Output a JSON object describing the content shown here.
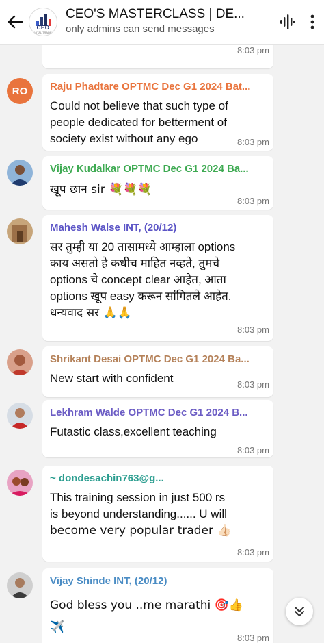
{
  "header": {
    "title": "CEO'S MASTERCLASS | DE...",
    "subtitle": "only admins can send messages",
    "logo_text": "CEO",
    "logo_sub": "VITAL TRADE"
  },
  "messages": [
    {
      "time": "8:03 pm"
    },
    {
      "avatar_initials": "RO",
      "sender": "Raju Phadtare OPTMC Dec G1 2024 Bat...",
      "sender_color": "#e9743d",
      "text_lines": [
        "Could not believe that such type of",
        "people dedicated for betterment of",
        "society exist without any ego"
      ],
      "time": "8:03 pm"
    },
    {
      "sender": "Vijay Kudalkar OPTMC Dec G1 2024 Ba...",
      "sender_color": "#3eaa52",
      "text": "खूप छान sir 💐💐💐",
      "time": "8:03 pm"
    },
    {
      "sender": "Mahesh Walse INT, (20/12)",
      "sender_color": "#5b54c6",
      "text_lines": [
        "सर तुम्ही या 20 तासामध्ये आम्हाला options",
        "काय असतो हे कधीच माहित नव्हते, तुमचे",
        "options चे concept clear आहेत, आता",
        "options खूप easy करून सांगितले आहेत.",
        "धन्यवाद सर 🙏🙏"
      ],
      "time": "8:03 pm"
    },
    {
      "sender": "Shrikant Desai OPTMC Dec G1 2024 Ba...",
      "sender_color": "#b5825a",
      "text": "New start with confident",
      "time": "8:03 pm"
    },
    {
      "sender": "Lekhram Walde OPTMC Dec G1 2024 B...",
      "sender_color": "#6b5cc4",
      "text": "Futastic class,excellent teaching",
      "time": "8:03 pm"
    },
    {
      "sender": "~ dondesachin763@g...",
      "sender_color": "#2a9d8f",
      "text_lines": [
        "This training session in just 500 rs",
        "is beyond understanding...... U will",
        "become very popular trader 👍🏻"
      ],
      "time": "8:03 pm"
    },
    {
      "sender": "Vijay Shinde INT, (20/12)",
      "sender_color": "#4a8cc4",
      "text_lines": [
        "God bless you  ..me marathi 🎯👍",
        "✈️"
      ],
      "time": "8:03 pm"
    }
  ]
}
